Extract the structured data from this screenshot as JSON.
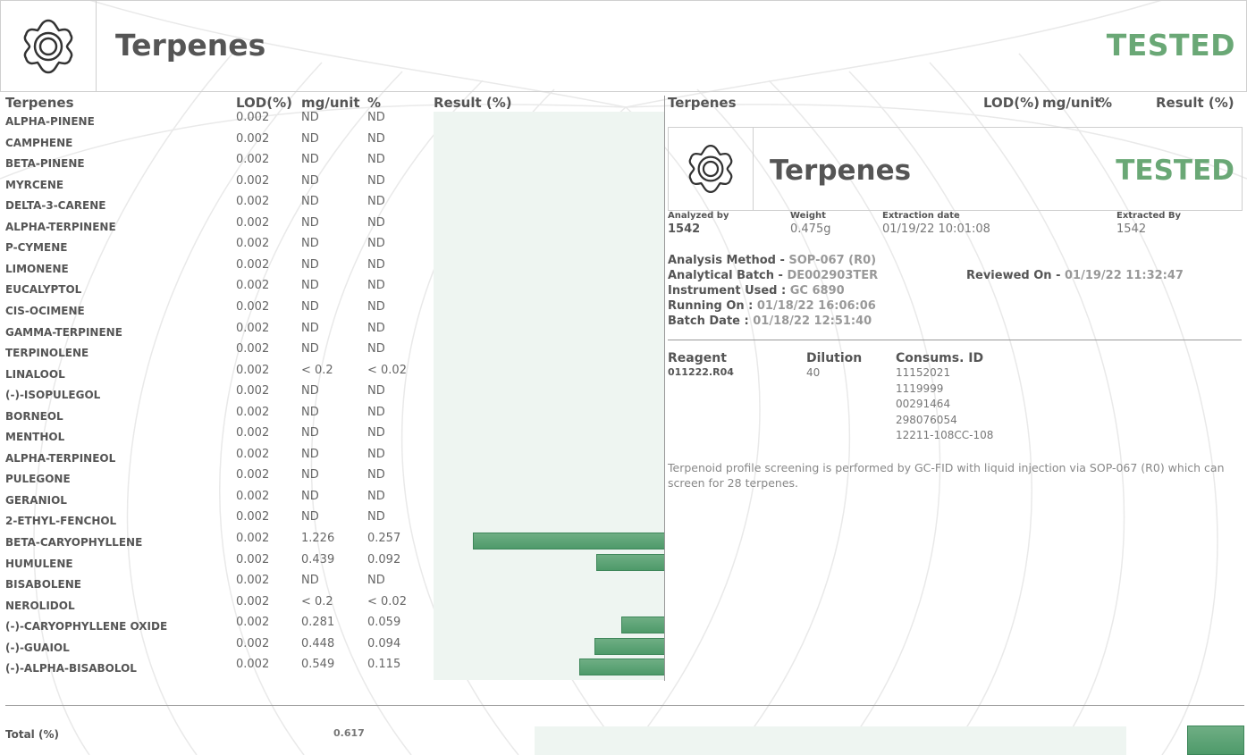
{
  "header": {
    "title": "Terpenes",
    "status": "TESTED",
    "logo_icon": "flower-icon"
  },
  "left_table": {
    "headers": {
      "name": "Terpenes",
      "lod": "LOD(%)",
      "mg": "mg/unit",
      "pct": "%",
      "result": "Result (%)"
    },
    "rows": [
      {
        "name": "ALPHA-PINENE",
        "lod": "0.002",
        "mg": "ND",
        "pct": "ND",
        "result": 0
      },
      {
        "name": "CAMPHENE",
        "lod": "0.002",
        "mg": "ND",
        "pct": "ND",
        "result": 0
      },
      {
        "name": "BETA-PINENE",
        "lod": "0.002",
        "mg": "ND",
        "pct": "ND",
        "result": 0
      },
      {
        "name": "MYRCENE",
        "lod": "0.002",
        "mg": "ND",
        "pct": "ND",
        "result": 0
      },
      {
        "name": "DELTA-3-CARENE",
        "lod": "0.002",
        "mg": "ND",
        "pct": "ND",
        "result": 0
      },
      {
        "name": "ALPHA-TERPINENE",
        "lod": "0.002",
        "mg": "ND",
        "pct": "ND",
        "result": 0
      },
      {
        "name": "P-CYMENE",
        "lod": "0.002",
        "mg": "ND",
        "pct": "ND",
        "result": 0
      },
      {
        "name": "LIMONENE",
        "lod": "0.002",
        "mg": "ND",
        "pct": "ND",
        "result": 0
      },
      {
        "name": "EUCALYPTOL",
        "lod": "0.002",
        "mg": "ND",
        "pct": "ND",
        "result": 0
      },
      {
        "name": "CIS-OCIMENE",
        "lod": "0.002",
        "mg": "ND",
        "pct": "ND",
        "result": 0
      },
      {
        "name": "GAMMA-TERPINENE",
        "lod": "0.002",
        "mg": "ND",
        "pct": "ND",
        "result": 0
      },
      {
        "name": "TERPINOLENE",
        "lod": "0.002",
        "mg": "ND",
        "pct": "ND",
        "result": 0
      },
      {
        "name": "LINALOOL",
        "lod": "0.002",
        "mg": "< 0.2",
        "pct": "< 0.02",
        "result": 0
      },
      {
        "name": "(-)-ISOPULEGOL",
        "lod": "0.002",
        "mg": "ND",
        "pct": "ND",
        "result": 0
      },
      {
        "name": "BORNEOL",
        "lod": "0.002",
        "mg": "ND",
        "pct": "ND",
        "result": 0
      },
      {
        "name": "MENTHOL",
        "lod": "0.002",
        "mg": "ND",
        "pct": "ND",
        "result": 0
      },
      {
        "name": "ALPHA-TERPINEOL",
        "lod": "0.002",
        "mg": "ND",
        "pct": "ND",
        "result": 0
      },
      {
        "name": "PULEGONE",
        "lod": "0.002",
        "mg": "ND",
        "pct": "ND",
        "result": 0
      },
      {
        "name": "GERANIOL",
        "lod": "0.002",
        "mg": "ND",
        "pct": "ND",
        "result": 0
      },
      {
        "name": "2-ETHYL-FENCHOL",
        "lod": "0.002",
        "mg": "ND",
        "pct": "ND",
        "result": 0
      },
      {
        "name": "BETA-CARYOPHYLLENE",
        "lod": "0.002",
        "mg": "1.226",
        "pct": "0.257",
        "result": 0.257
      },
      {
        "name": "HUMULENE",
        "lod": "0.002",
        "mg": "0.439",
        "pct": "0.092",
        "result": 0.092
      },
      {
        "name": "BISABOLENE",
        "lod": "0.002",
        "mg": "ND",
        "pct": "ND",
        "result": 0
      },
      {
        "name": "NEROLIDOL",
        "lod": "0.002",
        "mg": "< 0.2",
        "pct": "< 0.02",
        "result": 0
      },
      {
        "name": "(-)-CARYOPHYLLENE OXIDE",
        "lod": "0.002",
        "mg": "0.281",
        "pct": "0.059",
        "result": 0.059
      },
      {
        "name": "(-)-GUAIOL",
        "lod": "0.002",
        "mg": "0.448",
        "pct": "0.094",
        "result": 0.094
      },
      {
        "name": "(-)-ALPHA-BISABOLOL",
        "lod": "0.002",
        "mg": "0.549",
        "pct": "0.115",
        "result": 0.115
      }
    ]
  },
  "right_headers": {
    "name": "Terpenes",
    "lod": "LOD(%)",
    "mg": "mg/unit",
    "pct": "%",
    "result": "Result (%)"
  },
  "card": {
    "title": "Terpenes",
    "status": "TESTED",
    "logo_icon": "flower-icon"
  },
  "meta": {
    "analyzed_by_label": "Analyzed by",
    "analyzed_by": "1542",
    "weight_label": "Weight",
    "weight": "0.475g",
    "extraction_date_label": "Extraction date",
    "extraction_date": "01/19/22 10:01:08",
    "extracted_by_label": "Extracted By",
    "extracted_by": "1542"
  },
  "analysis": {
    "method_label": "Analysis Method - ",
    "method": "SOP-067 (R0)",
    "batch_label": "Analytical Batch - ",
    "batch": "DE002903TER",
    "instrument_label": "Instrument Used : ",
    "instrument": "GC 6890",
    "running_label": "Running On : ",
    "running": "01/18/22 16:06:06",
    "batch_date_label": "Batch Date : ",
    "batch_date": "01/18/22 12:51:40",
    "reviewed_label": "Reviewed On - ",
    "reviewed": "01/19/22 11:32:47"
  },
  "reagents": {
    "reagent_label": "Reagent",
    "dilution_label": "Dilution",
    "consums_label": "Consums. ID",
    "reagent": "011222.R04",
    "dilution": "40",
    "consums": [
      "11152021",
      "1119999",
      "00291464",
      "298076054",
      "12211-108CC-108"
    ]
  },
  "note": "Terpenoid profile screening is performed by GC-FID with liquid injection via SOP-067 (R0) which can screen for 28 terpenes.",
  "total": {
    "label": "Total (%)",
    "value": "0.617",
    "result": 0.617
  },
  "chart_data": {
    "type": "bar",
    "orientation": "horizontal",
    "categories": [
      "BETA-CARYOPHYLLENE",
      "HUMULENE",
      "(-)-CARYOPHYLLENE OXIDE",
      "(-)-GUAIOL",
      "(-)-ALPHA-BISABOLOL"
    ],
    "values": [
      0.257,
      0.092,
      0.059,
      0.094,
      0.115
    ],
    "xlim": [
      0,
      0.257
    ],
    "colors": {
      "bar": "#5aa374",
      "track": "#eef5f1"
    }
  }
}
